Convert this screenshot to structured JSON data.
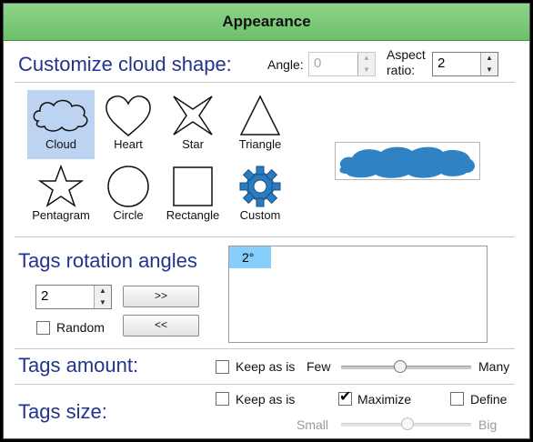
{
  "title": "Appearance",
  "shape_section": {
    "heading": "Customize cloud shape:",
    "angle_label": "Angle:",
    "angle_value": "0",
    "aspect_label_1": "Aspect",
    "aspect_label_2": "ratio:",
    "aspect_value": "2",
    "shapes": [
      "Cloud",
      "Heart",
      "Star",
      "Triangle",
      "Pentagram",
      "Circle",
      "Rectangle",
      "Custom"
    ],
    "selected_shape": "Cloud"
  },
  "rotation_section": {
    "heading": "Tags rotation angles",
    "count_value": "2",
    "add_button": ">>",
    "remove_button": "<<",
    "random_label": "Random",
    "random_checked": false,
    "angles": [
      "2°"
    ]
  },
  "amount_section": {
    "heading": "Tags amount:",
    "keep_label": "Keep as is",
    "keep_checked": false,
    "min_label": "Few",
    "max_label": "Many",
    "level": 0.45
  },
  "size_section": {
    "heading": "Tags size:",
    "keep_label": "Keep as is",
    "keep_checked": false,
    "maximize_label": "Maximize",
    "maximize_checked": true,
    "define_label": "Define",
    "define_checked": false,
    "min_label": "Small",
    "max_label": "Big",
    "level": 0.5
  },
  "colors": {
    "heading": "#22348c",
    "titlebar": "#6cc06a",
    "selection": "#bcd3f2",
    "list_selection": "#87cefa",
    "preview_fill": "#2f83c5"
  }
}
